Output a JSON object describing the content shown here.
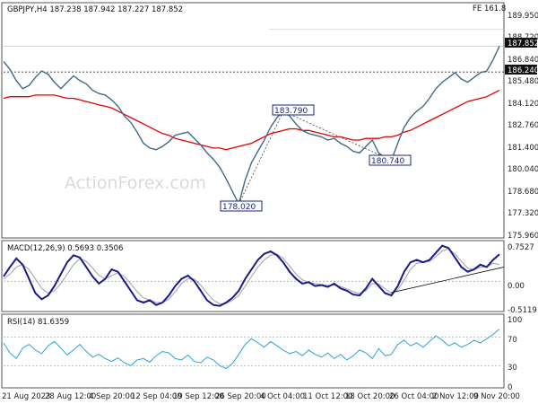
{
  "chart_data": [
    {
      "type": "line",
      "title": "GBPJPY,H4  187.238  187.942  187.227  187.852",
      "fib_label": "FE 161.8",
      "watermark": "ActionForex.com",
      "ylim": [
        175.96,
        190.5
      ],
      "y_ticks": [
        "189.950",
        "188.720",
        "186.840",
        "185.480",
        "184.120",
        "182.760",
        "181.400",
        "180.040",
        "178.680",
        "177.320",
        "175.960"
      ],
      "x_ticks": [
        "21 Aug 2023",
        "28 Aug 12:00",
        "4 Sep 20:00",
        "12 Sep 04:00",
        "19 Sep 12:00",
        "26 Sep 20:00",
        "4 Oct 04:00",
        "11 Oct 12:00",
        "18 Oct 20:00",
        "26 Oct 04:00",
        "2 Nov 12:00",
        "9 Nov 20:00"
      ],
      "price_labels": {
        "current": "187.852",
        "level": "186.240"
      },
      "annotations": [
        "183.790",
        "180.740",
        "178.020"
      ],
      "series": [
        {
          "values": [
            186.9,
            186.4,
            185.7,
            185.2,
            185.4,
            185.9,
            186.3,
            186.1,
            185.6,
            185.2,
            185.6,
            186.0,
            185.7,
            185.5,
            185.1,
            184.9,
            184.8,
            184.5,
            184.1,
            183.5,
            183.1,
            182.5,
            181.8,
            181.5,
            181.4,
            181.6,
            181.9,
            182.3,
            182.4,
            182.5,
            182.1,
            181.7,
            181.2,
            180.8,
            180.3,
            179.6,
            178.8,
            178.02,
            179.5,
            180.6,
            181.3,
            182.0,
            182.8,
            183.4,
            183.79,
            183.5,
            183.0,
            182.6,
            182.4,
            182.3,
            182.2,
            182.0,
            182.1,
            181.8,
            181.6,
            181.3,
            181.2,
            181.6,
            182.0,
            181.2,
            180.9,
            180.74,
            181.8,
            182.8,
            183.4,
            183.8,
            184.1,
            184.6,
            185.2,
            185.6,
            185.9,
            186.2,
            185.8,
            185.6,
            185.9,
            186.2,
            186.3,
            187.0,
            187.852
          ]
        },
        {
          "values": [
            184.6,
            184.7,
            184.7,
            184.7,
            184.7,
            184.8,
            184.8,
            184.8,
            184.8,
            184.7,
            184.6,
            184.6,
            184.5,
            184.4,
            184.3,
            184.2,
            184.1,
            184.0,
            183.8,
            183.6,
            183.4,
            183.2,
            183.0,
            182.8,
            182.6,
            182.4,
            182.3,
            182.1,
            182.0,
            181.9,
            181.8,
            181.7,
            181.6,
            181.5,
            181.5,
            181.4,
            181.5,
            181.6,
            181.7,
            181.8,
            182.0,
            182.2,
            182.4,
            182.5,
            182.6,
            182.7,
            182.7,
            182.6,
            182.6,
            182.5,
            182.4,
            182.3,
            182.2,
            182.2,
            182.1,
            182.0,
            182.0,
            182.1,
            182.1,
            182.1,
            182.2,
            182.2,
            182.3,
            182.5,
            182.6,
            182.8,
            183.0,
            183.2,
            183.4,
            183.6,
            183.8,
            184.0,
            184.2,
            184.4,
            184.5,
            184.6,
            184.7,
            184.9,
            185.1
          ]
        }
      ],
      "fe_level": 188.9
    },
    {
      "type": "line",
      "title": "MACD(12,26,9)  0.5693  0.3506",
      "ylim": [
        -0.62,
        0.82
      ],
      "y_ticks": [
        "0.7527",
        "0.00",
        "-0.5119"
      ],
      "series": [
        {
          "values": [
            0.1,
            0.3,
            0.48,
            0.35,
            0.05,
            -0.25,
            -0.38,
            -0.3,
            -0.1,
            0.15,
            0.4,
            0.55,
            0.5,
            0.3,
            0.1,
            -0.05,
            0.05,
            0.25,
            0.2,
            0.0,
            -0.2,
            -0.4,
            -0.45,
            -0.4,
            -0.5,
            -0.45,
            -0.3,
            -0.1,
            0.05,
            0.12,
            0.0,
            -0.2,
            -0.4,
            -0.5,
            -0.52,
            -0.45,
            -0.35,
            -0.2,
            0.05,
            0.25,
            0.45,
            0.58,
            0.63,
            0.55,
            0.4,
            0.2,
            0.05,
            -0.05,
            -0.02,
            -0.1,
            -0.08,
            -0.12,
            -0.05,
            -0.15,
            -0.2,
            -0.28,
            -0.3,
            -0.15,
            0.05,
            -0.1,
            -0.25,
            -0.3,
            -0.1,
            0.2,
            0.4,
            0.45,
            0.4,
            0.45,
            0.6,
            0.75,
            0.7,
            0.5,
            0.3,
            0.2,
            0.25,
            0.35,
            0.3,
            0.45,
            0.5693
          ]
        },
        {
          "values": [
            0.05,
            0.15,
            0.3,
            0.35,
            0.25,
            0.05,
            -0.15,
            -0.25,
            -0.2,
            -0.05,
            0.15,
            0.35,
            0.48,
            0.42,
            0.28,
            0.12,
            0.05,
            0.12,
            0.18,
            0.1,
            -0.05,
            -0.22,
            -0.35,
            -0.4,
            -0.45,
            -0.45,
            -0.38,
            -0.22,
            -0.05,
            0.05,
            0.05,
            -0.08,
            -0.25,
            -0.4,
            -0.48,
            -0.47,
            -0.4,
            -0.3,
            -0.1,
            0.1,
            0.3,
            0.45,
            0.55,
            0.57,
            0.48,
            0.32,
            0.15,
            0.03,
            -0.02,
            -0.05,
            -0.07,
            -0.09,
            -0.08,
            -0.11,
            -0.16,
            -0.22,
            -0.26,
            -0.2,
            -0.05,
            -0.06,
            -0.16,
            -0.25,
            -0.18,
            0.02,
            0.25,
            0.38,
            0.4,
            0.42,
            0.52,
            0.64,
            0.68,
            0.58,
            0.42,
            0.28,
            0.24,
            0.3,
            0.3,
            0.38,
            0.3506
          ]
        }
      ],
      "trendline": [
        -0.24,
        0.3
      ]
    },
    {
      "type": "line",
      "title": "RSI(14)  81.6359",
      "ylim": [
        0,
        100
      ],
      "y_ticks": [
        "100",
        "70",
        "30",
        "0"
      ],
      "levels": [
        70,
        30
      ],
      "series": [
        {
          "values": [
            62,
            48,
            40,
            55,
            60,
            52,
            47,
            58,
            64,
            55,
            45,
            52,
            60,
            50,
            42,
            46,
            40,
            36,
            41,
            34,
            30,
            38,
            40,
            35,
            44,
            50,
            48,
            40,
            38,
            45,
            36,
            34,
            42,
            38,
            30,
            26,
            33,
            46,
            60,
            68,
            62,
            56,
            64,
            58,
            52,
            47,
            50,
            44,
            52,
            46,
            42,
            48,
            40,
            46,
            38,
            44,
            52,
            48,
            40,
            54,
            44,
            46,
            60,
            66,
            58,
            62,
            56,
            64,
            72,
            66,
            58,
            62,
            56,
            60,
            66,
            62,
            68,
            74,
            81.6359
          ]
        }
      ]
    }
  ]
}
